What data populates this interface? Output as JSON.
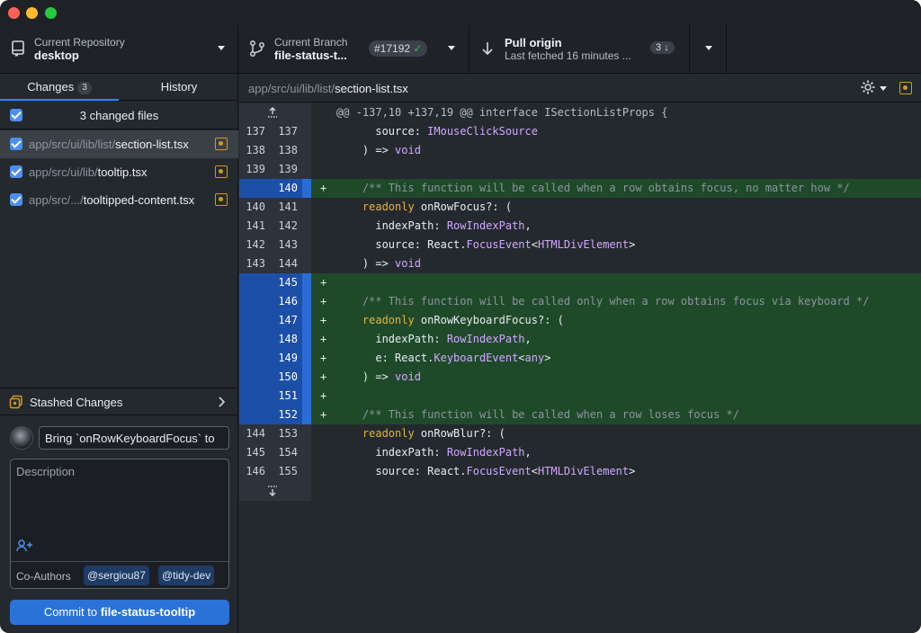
{
  "window": {
    "traffic_lights": [
      "close",
      "minimize",
      "zoom"
    ]
  },
  "toolbar": {
    "repo": {
      "label": "Current Repository",
      "value": "desktop",
      "icon": "repo-icon"
    },
    "branch": {
      "label": "Current Branch",
      "value": "file-status-t...",
      "pr": "#17192",
      "pr_check": "✓",
      "icon": "branch-icon"
    },
    "pull": {
      "label": "Pull origin",
      "sub": "Last fetched 16 minutes ...",
      "count": "3",
      "count_arrow": "↓",
      "icon": "arrow-down-icon"
    }
  },
  "sidebar": {
    "tabs": [
      {
        "label": "Changes",
        "count": "3"
      },
      {
        "label": "History"
      }
    ],
    "changed_header": "3 changed files",
    "files": [
      {
        "dir": "app/src/ui/lib/list/",
        "name": "section-list.tsx",
        "selected": true
      },
      {
        "dir": "app/src/ui/lib/",
        "name": "tooltip.tsx",
        "selected": false
      },
      {
        "dir": "app/src/.../",
        "name": "tooltipped-content.tsx",
        "selected": false
      }
    ],
    "stash_label": "Stashed Changes",
    "commit": {
      "summary": "Bring `onRowKeyboardFocus` to",
      "description_placeholder": "Description",
      "coauthors_label": "Co-Authors",
      "coauthors": [
        "@sergiou87",
        "@tidy-dev"
      ],
      "button_prefix": "Commit to ",
      "button_branch": "file-status-tooltip"
    }
  },
  "main": {
    "path_dir": "app/src/ui/lib/list/",
    "path_file": "section-list.tsx",
    "hunk_header": "@@ -137,10 +137,19 @@ interface ISectionListProps {",
    "lines": [
      {
        "old": "137",
        "new": "137",
        "type": "ctx",
        "mark": "",
        "tokens": [
          [
            "",
            "      "
          ],
          [
            "",
            "source: "
          ],
          [
            "t",
            "IMouseClickSource"
          ]
        ]
      },
      {
        "old": "138",
        "new": "138",
        "type": "ctx",
        "mark": "",
        "tokens": [
          [
            "",
            "    ) => "
          ],
          [
            "k",
            "void"
          ]
        ]
      },
      {
        "old": "139",
        "new": "139",
        "type": "ctx",
        "mark": "",
        "tokens": [
          [
            "",
            ""
          ]
        ]
      },
      {
        "old": "",
        "new": "140",
        "type": "add",
        "mark": "+",
        "tokens": [
          [
            "c",
            "    /** This function will be called when a row obtains focus, no matter how */"
          ]
        ]
      },
      {
        "old": "140",
        "new": "141",
        "type": "ctx",
        "mark": "",
        "tokens": [
          [
            "y",
            "    readonly "
          ],
          [
            "",
            "onRowFocus?: ("
          ]
        ]
      },
      {
        "old": "141",
        "new": "142",
        "type": "ctx",
        "mark": "",
        "tokens": [
          [
            "",
            "      indexPath: "
          ],
          [
            "t",
            "RowIndexPath"
          ],
          [
            "",
            ","
          ]
        ]
      },
      {
        "old": "142",
        "new": "143",
        "type": "ctx",
        "mark": "",
        "tokens": [
          [
            "",
            "      source: React."
          ],
          [
            "t",
            "FocusEvent"
          ],
          [
            "",
            "<"
          ],
          [
            "t",
            "HTMLDivElement"
          ],
          [
            "",
            ">"
          ]
        ]
      },
      {
        "old": "143",
        "new": "144",
        "type": "ctx",
        "mark": "",
        "tokens": [
          [
            "",
            "    ) => "
          ],
          [
            "k",
            "void"
          ]
        ]
      },
      {
        "old": "",
        "new": "145",
        "type": "add",
        "mark": "+",
        "tokens": [
          [
            "",
            ""
          ]
        ]
      },
      {
        "old": "",
        "new": "146",
        "type": "add",
        "mark": "+",
        "tokens": [
          [
            "c",
            "    /** This function will be called only when a row obtains focus via keyboard */"
          ]
        ]
      },
      {
        "old": "",
        "new": "147",
        "type": "add",
        "mark": "+",
        "tokens": [
          [
            "y",
            "    readonly "
          ],
          [
            "",
            "onRowKeyboardFocus?: ("
          ]
        ]
      },
      {
        "old": "",
        "new": "148",
        "type": "add",
        "mark": "+",
        "tokens": [
          [
            "",
            "      indexPath: "
          ],
          [
            "t",
            "RowIndexPath"
          ],
          [
            "",
            ","
          ]
        ]
      },
      {
        "old": "",
        "new": "149",
        "type": "add",
        "mark": "+",
        "tokens": [
          [
            "",
            "      e: React."
          ],
          [
            "t",
            "KeyboardEvent"
          ],
          [
            "",
            "<"
          ],
          [
            "t",
            "any"
          ],
          [
            "",
            ">"
          ]
        ]
      },
      {
        "old": "",
        "new": "150",
        "type": "add",
        "mark": "+",
        "tokens": [
          [
            "",
            "    ) => "
          ],
          [
            "k",
            "void"
          ]
        ]
      },
      {
        "old": "",
        "new": "151",
        "type": "add",
        "mark": "+",
        "tokens": [
          [
            "",
            ""
          ]
        ]
      },
      {
        "old": "",
        "new": "152",
        "type": "add",
        "mark": "+",
        "tokens": [
          [
            "c",
            "    /** This function will be called when a row loses focus */"
          ]
        ]
      },
      {
        "old": "144",
        "new": "153",
        "type": "ctx",
        "mark": "",
        "tokens": [
          [
            "y",
            "    readonly "
          ],
          [
            "",
            "onRowBlur?: ("
          ]
        ]
      },
      {
        "old": "145",
        "new": "154",
        "type": "ctx",
        "mark": "",
        "tokens": [
          [
            "",
            "      indexPath: "
          ],
          [
            "t",
            "RowIndexPath"
          ],
          [
            "",
            ","
          ]
        ]
      },
      {
        "old": "146",
        "new": "155",
        "type": "ctx",
        "mark": "",
        "tokens": [
          [
            "",
            "      source: React."
          ],
          [
            "t",
            "FocusEvent"
          ],
          [
            "",
            "<"
          ],
          [
            "t",
            "HTMLDivElement"
          ],
          [
            "",
            ">"
          ]
        ]
      }
    ]
  },
  "colors": {
    "accent": "#2f81f7",
    "added_bg": "#1f4a2a",
    "added_gutter": "#1c4fa8",
    "modified": "#d29922"
  }
}
